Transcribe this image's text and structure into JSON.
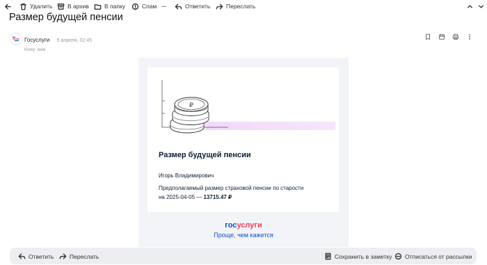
{
  "toolbar": {
    "delete": "Удалить",
    "archive": "В архив",
    "folder": "В папку",
    "spam": "Спам",
    "more": "···",
    "reply": "Ответить",
    "forward": "Переслать"
  },
  "message": {
    "subject": "Размер будущей пенсии",
    "sender_name": "Госуслуги",
    "date": "5 апреля, 02:45",
    "to": "Кому: вам"
  },
  "email_body": {
    "heading": "Размер будущей пенсии",
    "recipient_name": "Игорь Владимирович",
    "line1": "Предполагаемый размер страховой пенсии по старости",
    "line2_prefix": "на 2025-04-05 — ",
    "amount": "13715.47 ₽",
    "logo_part1": "гос",
    "logo_part2": "услуги",
    "slogan": "Проще, чем кажется"
  },
  "bottom_bar": {
    "reply": "Ответить",
    "forward": "Переслать",
    "save_note": "Сохранить в заметку",
    "unsubscribe": "Отписаться от рассылки"
  },
  "colors": {
    "brand_blue": "#0d4cd3",
    "brand_red": "#ee3f58",
    "mail_bg": "#f3f4f7"
  }
}
